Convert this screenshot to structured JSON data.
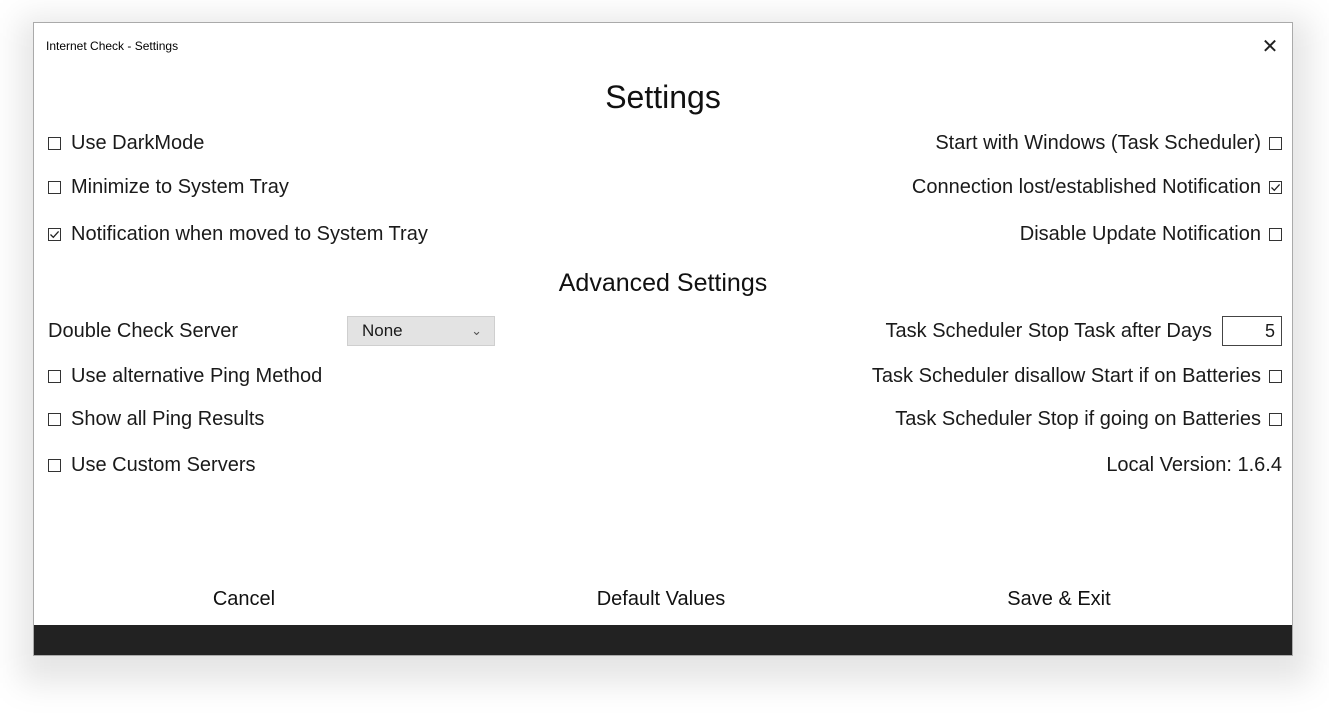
{
  "window": {
    "title": "Internet Check - Settings",
    "close": "✕"
  },
  "headings": {
    "settings": "Settings",
    "advanced": "Advanced Settings"
  },
  "left_options": [
    {
      "label": "Use DarkMode",
      "checked": false
    },
    {
      "label": "Minimize to System Tray",
      "checked": false
    },
    {
      "label": "Notification when moved to System Tray",
      "checked": true
    }
  ],
  "right_options": [
    {
      "label": "Start with Windows (Task Scheduler)",
      "checked": false
    },
    {
      "label": "Connection lost/established Notification",
      "checked": true
    },
    {
      "label": "Disable Update Notification",
      "checked": false
    }
  ],
  "advanced": {
    "double_check_label": "Double Check Server",
    "double_check_value": "None",
    "stop_after_days_label": "Task Scheduler Stop Task after Days",
    "stop_after_days_value": "5",
    "left_options": [
      {
        "label": "Use alternative Ping Method",
        "checked": false
      },
      {
        "label": "Show all Ping Results",
        "checked": false
      },
      {
        "label": "Use Custom Servers",
        "checked": false
      }
    ],
    "right_options": [
      {
        "label": "Task Scheduler disallow Start if on Batteries",
        "checked": false
      },
      {
        "label": "Task Scheduler Stop if going on Batteries",
        "checked": false
      }
    ],
    "version": "Local Version: 1.6.4"
  },
  "footer": {
    "cancel": "Cancel",
    "defaults": "Default Values",
    "save": "Save & Exit"
  }
}
